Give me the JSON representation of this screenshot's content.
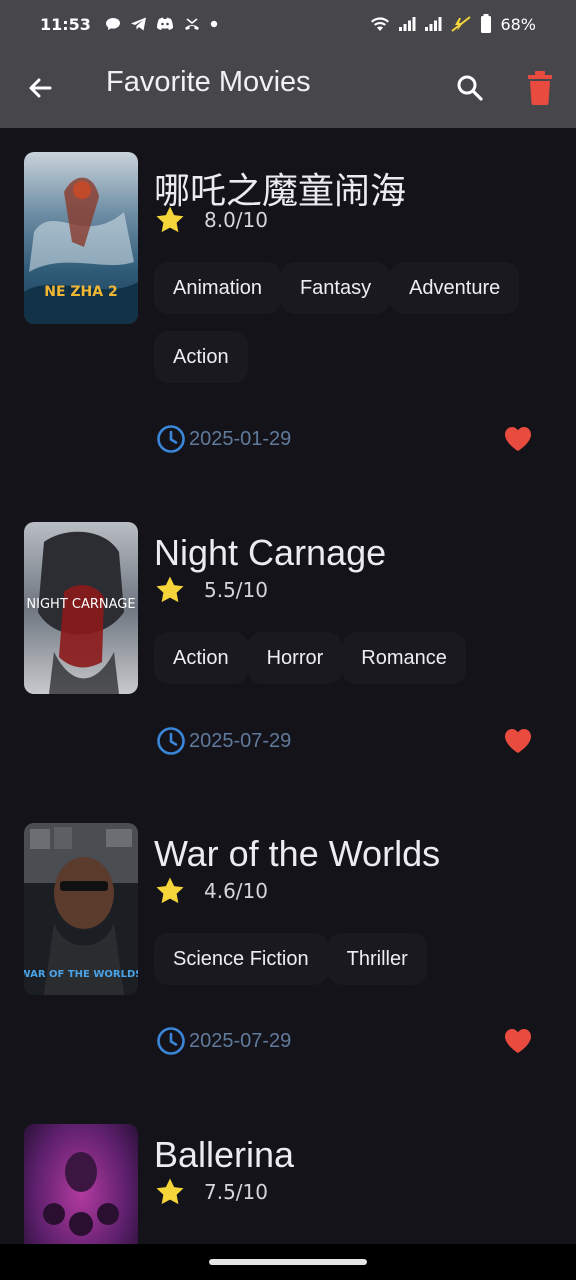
{
  "status_bar": {
    "time": "11:53",
    "battery": "68%"
  },
  "app_bar": {
    "title": "Favorite Movies"
  },
  "movies": [
    {
      "title": "哪吒之魔童闹海",
      "rating": "8.0/10",
      "genres": [
        "Animation",
        "Fantasy",
        "Adventure",
        "Action"
      ],
      "date": "2025-01-29",
      "poster_text": "NE ZHA 2"
    },
    {
      "title": "Night Carnage",
      "rating": "5.5/10",
      "genres": [
        "Action",
        "Horror",
        "Romance"
      ],
      "date": "2025-07-29",
      "poster_text": "NIGHT CARNAGE"
    },
    {
      "title": "War of the Worlds",
      "rating": "4.6/10",
      "genres": [
        "Science Fiction",
        "Thriller"
      ],
      "date": "2025-07-29",
      "poster_text": "WAR OF THE WORLDS"
    },
    {
      "title": "Ballerina",
      "rating": "7.5/10",
      "genres": [],
      "date": "",
      "poster_text": ""
    }
  ],
  "colors": {
    "accent_star": "#f5d53a",
    "heart": "#e94b3f",
    "delete": "#e94b3f",
    "clock": "#3a86d8"
  }
}
